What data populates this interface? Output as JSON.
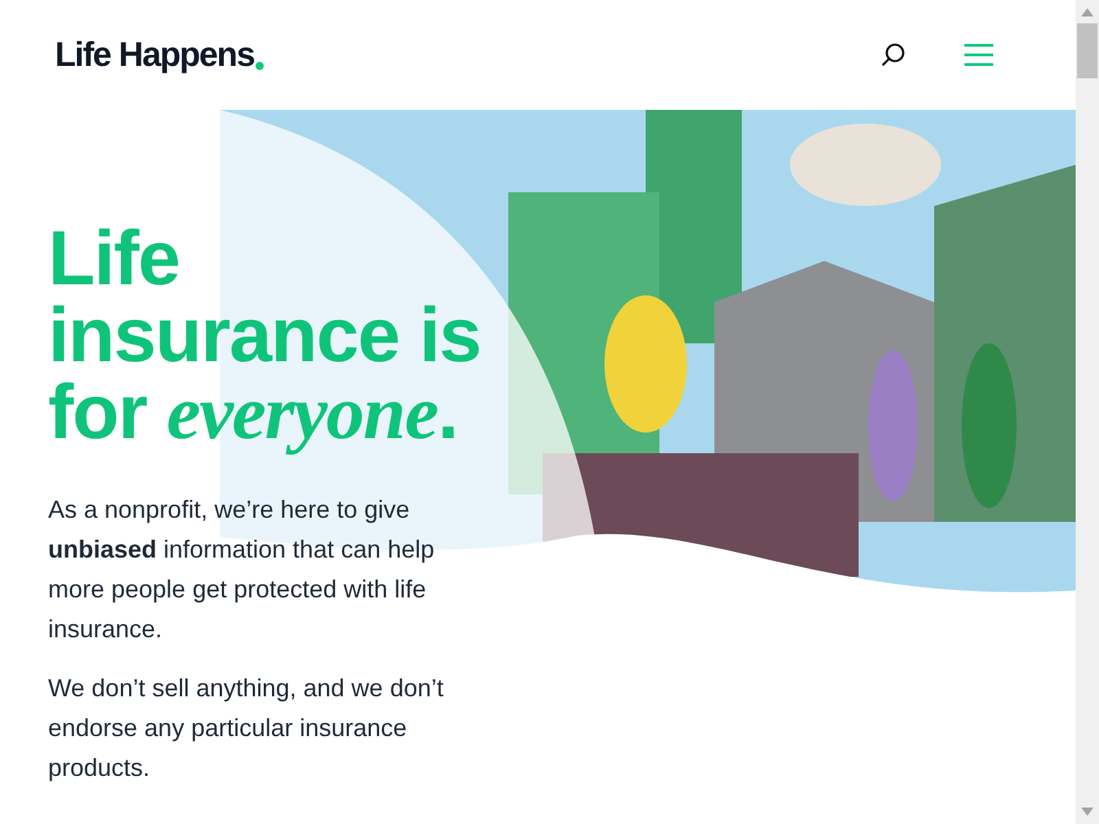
{
  "header": {
    "logo": "Life Happens"
  },
  "hero": {
    "headline": "Life insurance is for *everyone*.",
    "paragraphs": [
      "As a nonprofit, we’re here to give **unbiased** information that can help more people get protected with life insurance.",
      "We don’t sell anything, and we don’t endorse any particular insurance products."
    ]
  }
}
